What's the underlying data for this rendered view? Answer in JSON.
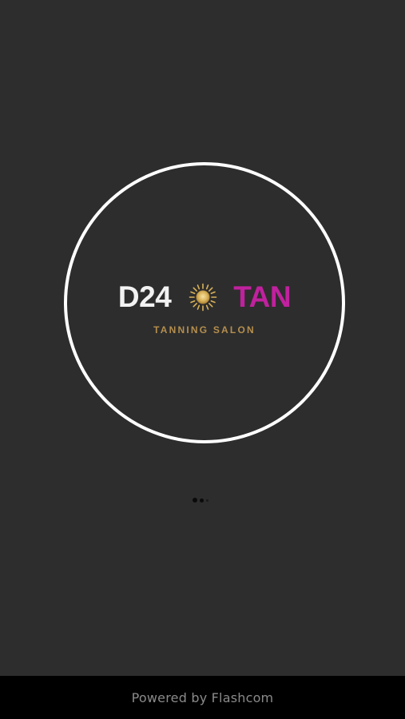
{
  "logo": {
    "brand_left": "D24",
    "brand_right": "TAN",
    "tagline": "TANNING SALON",
    "sun_icon": "sun-icon",
    "colors": {
      "brand_left": "#f2f2f2",
      "brand_right": "#c0219e",
      "tagline": "#b58e4e",
      "sun": "#d9b25a",
      "ring": "#ffffff"
    }
  },
  "loader": {
    "icon": "loading-dots-icon"
  },
  "footer": {
    "text": "Powered by Flashcom"
  },
  "background_color": "#2d2d2d"
}
